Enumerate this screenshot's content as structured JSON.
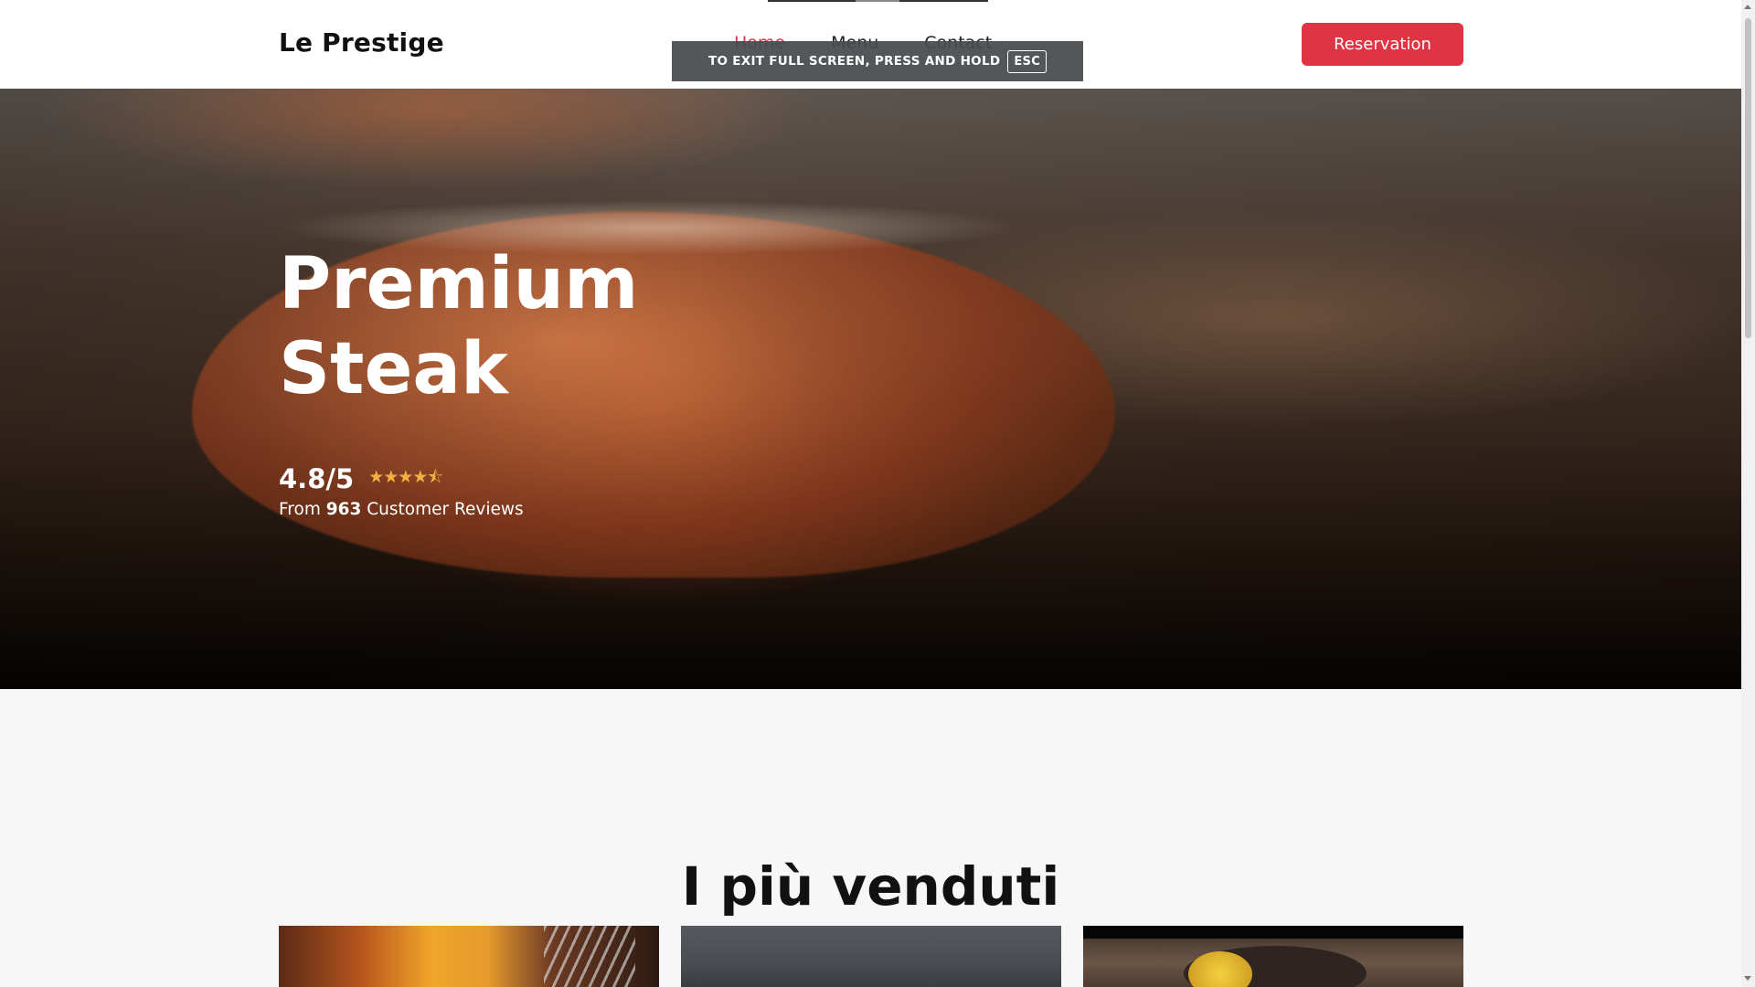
{
  "header": {
    "logo": "Le Prestige",
    "nav": [
      {
        "label": "Home",
        "active": true
      },
      {
        "label": "Menu",
        "active": false
      },
      {
        "label": "Contact",
        "active": false
      }
    ],
    "reservation_label": "Reservation"
  },
  "fullscreen_notice": {
    "text": "TO EXIT FULL SCREEN, PRESS AND HOLD",
    "key": "ESC"
  },
  "hero": {
    "title": "Premium Steak",
    "rating": "4.8/5",
    "stars": 4.5,
    "stars_glyphs": "★★★★⯪",
    "reviews_prefix": "From",
    "reviews_count": "963",
    "reviews_suffix": "Customer Reviews",
    "image": "grilled-steak-photo"
  },
  "bestsellers": {
    "title": "I più venduti",
    "cards": [
      {
        "image": "steak-with-beer-and-fork-photo"
      },
      {
        "image": "dish-on-grey-wood-photo"
      },
      {
        "image": "grilled-corn-on-pan-photo"
      }
    ]
  },
  "colors": {
    "accent": "#e03444",
    "star": "#f4b03e",
    "background": "#f7f7f7"
  }
}
